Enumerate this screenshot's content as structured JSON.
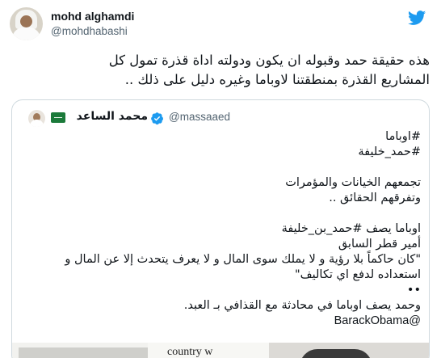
{
  "tweet": {
    "display_name": "mohd alghamdi",
    "handle": "@mohdhabashi",
    "avatar_icon": "user-avatar-photo",
    "brand_icon": "twitter-bird-icon",
    "brand_color": "#1d9bf0",
    "text_lines": [
      "هذه حقيقة حمد وقبوله ان يكون ودولته اداة قذرة تمول كل",
      "المشاريع القذرة بمنطقتنا لاوباما وغيره دليل على ذلك .."
    ]
  },
  "quote": {
    "display_name": "محمد الساعد",
    "handle": "@massaaed",
    "verified_icon": "verified-badge-icon",
    "flag_icon": "saudi-flag-icon",
    "lines": [
      "#اوباما",
      "#حمد_خليفة",
      "",
      "تجمعهم الخيانات والمؤمرات",
      "وتفرقهم الحقائق ..",
      "",
      "اوباما يصف #حمد_بن_خليفة",
      "أمير قطر السابق",
      "\"كان حاكماً بلا رؤية و لا يملك سوى المال و لا يعرف يتحدث إلا عن المال و",
      "استعداده لدفع اي تكاليف\"",
      "••",
      "وحمد يصف اوباما في محادثة مع القذافي بـ العبد."
    ],
    "mention": "@BarackObama",
    "media_caption": "country w"
  }
}
